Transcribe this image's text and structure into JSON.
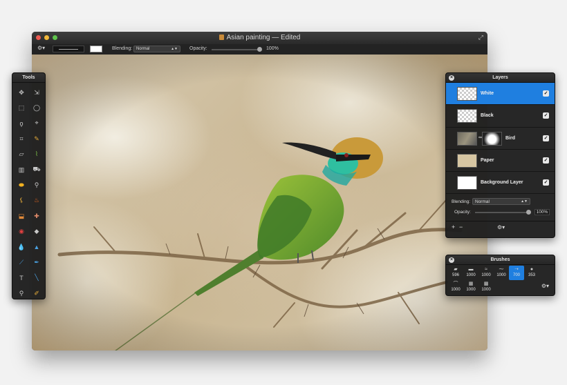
{
  "window": {
    "title": "Asian painting",
    "status": "— Edited",
    "fullscreen_icon": "⤢"
  },
  "toolbar": {
    "gear_icon": "⚙▾",
    "blending_label": "Blending:",
    "blending_value": "Normal",
    "opacity_label": "Opacity:",
    "opacity_value": "100%"
  },
  "tools": {
    "title": "Tools",
    "items": [
      {
        "name": "move-tool-icon",
        "glyph": "✥"
      },
      {
        "name": "arrange-tool-icon",
        "glyph": "⇲"
      },
      {
        "name": "rect-select-icon",
        "glyph": "⬚"
      },
      {
        "name": "ellipse-select-icon",
        "glyph": "◯"
      },
      {
        "name": "lasso-icon",
        "glyph": "ϙ"
      },
      {
        "name": "poly-lasso-icon",
        "glyph": "⌖"
      },
      {
        "name": "crop-icon",
        "glyph": "⌗"
      },
      {
        "name": "eyedropper-icon",
        "glyph": "✎"
      },
      {
        "name": "eraser-icon",
        "glyph": "▱"
      },
      {
        "name": "smudge-icon",
        "glyph": "⌇"
      },
      {
        "name": "gradient-icon",
        "glyph": "▥"
      },
      {
        "name": "bucket-icon",
        "glyph": "⛟"
      },
      {
        "name": "sponge-icon",
        "glyph": "⬬"
      },
      {
        "name": "pin-icon",
        "glyph": "⚲"
      },
      {
        "name": "paint-brush-icon",
        "glyph": "⚸"
      },
      {
        "name": "burn-icon",
        "glyph": "♨"
      },
      {
        "name": "stamp-icon",
        "glyph": "⬓"
      },
      {
        "name": "heal-icon",
        "glyph": "✚"
      },
      {
        "name": "red-eye-icon",
        "glyph": "◉"
      },
      {
        "name": "eraser-2-icon",
        "glyph": "◆"
      },
      {
        "name": "blur-icon",
        "glyph": "💧"
      },
      {
        "name": "sharpen-icon",
        "glyph": "▲"
      },
      {
        "name": "pencil-icon",
        "glyph": "⟋"
      },
      {
        "name": "pen-icon",
        "glyph": "✒"
      },
      {
        "name": "text-icon",
        "glyph": "T"
      },
      {
        "name": "line-icon",
        "glyph": "╲"
      },
      {
        "name": "zoom-icon",
        "glyph": "⚲"
      },
      {
        "name": "color-brush-icon",
        "glyph": "✐"
      }
    ]
  },
  "layers": {
    "title": "Layers",
    "items": [
      {
        "name": "White",
        "visible": true
      },
      {
        "name": "Black",
        "visible": true
      },
      {
        "name": "Bird",
        "visible": true
      },
      {
        "name": "Paper",
        "visible": true
      },
      {
        "name": "Background Layer",
        "visible": true
      }
    ],
    "blending_label": "Blending:",
    "blending_value": "Normal",
    "opacity_label": "Opacity:",
    "opacity_value": "100%",
    "add_icon": "+",
    "remove_icon": "−",
    "gear_icon": "⚙▾"
  },
  "brushes": {
    "title": "Brushes",
    "items": [
      "596",
      "1000",
      "1000",
      "1000",
      "700",
      "353",
      "1000",
      "1000",
      "1000"
    ],
    "selected_index": 4,
    "gear_icon": "⚙▾"
  },
  "colors": {
    "accent": "#1f7fe0"
  }
}
